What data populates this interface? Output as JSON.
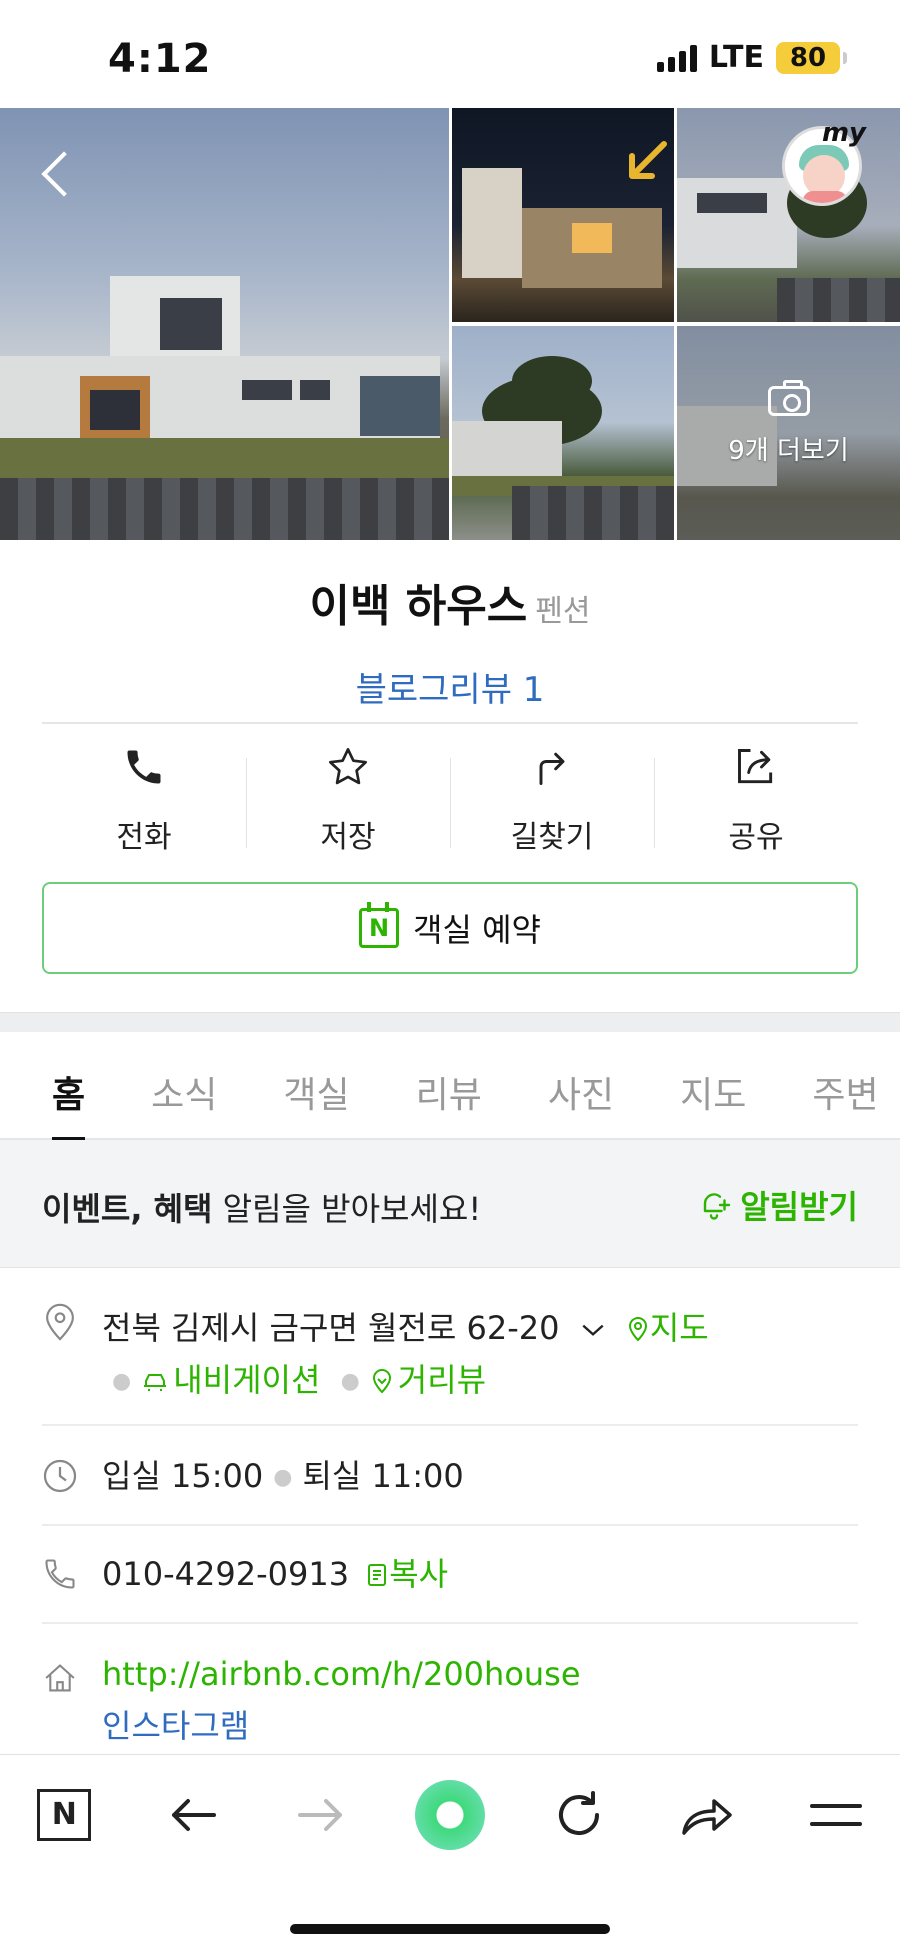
{
  "status": {
    "time": "4:12",
    "network": "LTE",
    "battery": "80"
  },
  "gallery": {
    "more_label": "9개 더보기",
    "my_label": "my"
  },
  "place": {
    "name": "이백 하우스",
    "category": "펜션",
    "blog_review": "블로그리뷰 1"
  },
  "actions": [
    {
      "label": "전화",
      "icon": "phone-icon"
    },
    {
      "label": "저장",
      "icon": "star-icon"
    },
    {
      "label": "길찾기",
      "icon": "directions-icon"
    },
    {
      "label": "공유",
      "icon": "share-icon"
    }
  ],
  "reserve": {
    "label": "객실 예약",
    "icon_letter": "N"
  },
  "tabs": [
    "홈",
    "소식",
    "객실",
    "리뷰",
    "사진",
    "지도",
    "주변"
  ],
  "alert": {
    "bold": "이벤트, 혜택",
    "text": " 알림을 받아보세요!",
    "button": "알림받기"
  },
  "address": {
    "text": "전북 김제시 금구면 월전로 62-20",
    "map": "지도",
    "navigation": "내비게이션",
    "street_view": "거리뷰"
  },
  "hours": {
    "checkin": "입실 15:00",
    "checkout": "퇴실 11:00"
  },
  "phone": {
    "number": "010-4292-0913",
    "copy": "복사"
  },
  "website": {
    "url": "http://airbnb.com/h/200house",
    "instagram": "인스타그램"
  },
  "colors": {
    "accent_green": "#2db400",
    "link_blue": "#2f6bbf",
    "battery": "#f5cc3a"
  }
}
